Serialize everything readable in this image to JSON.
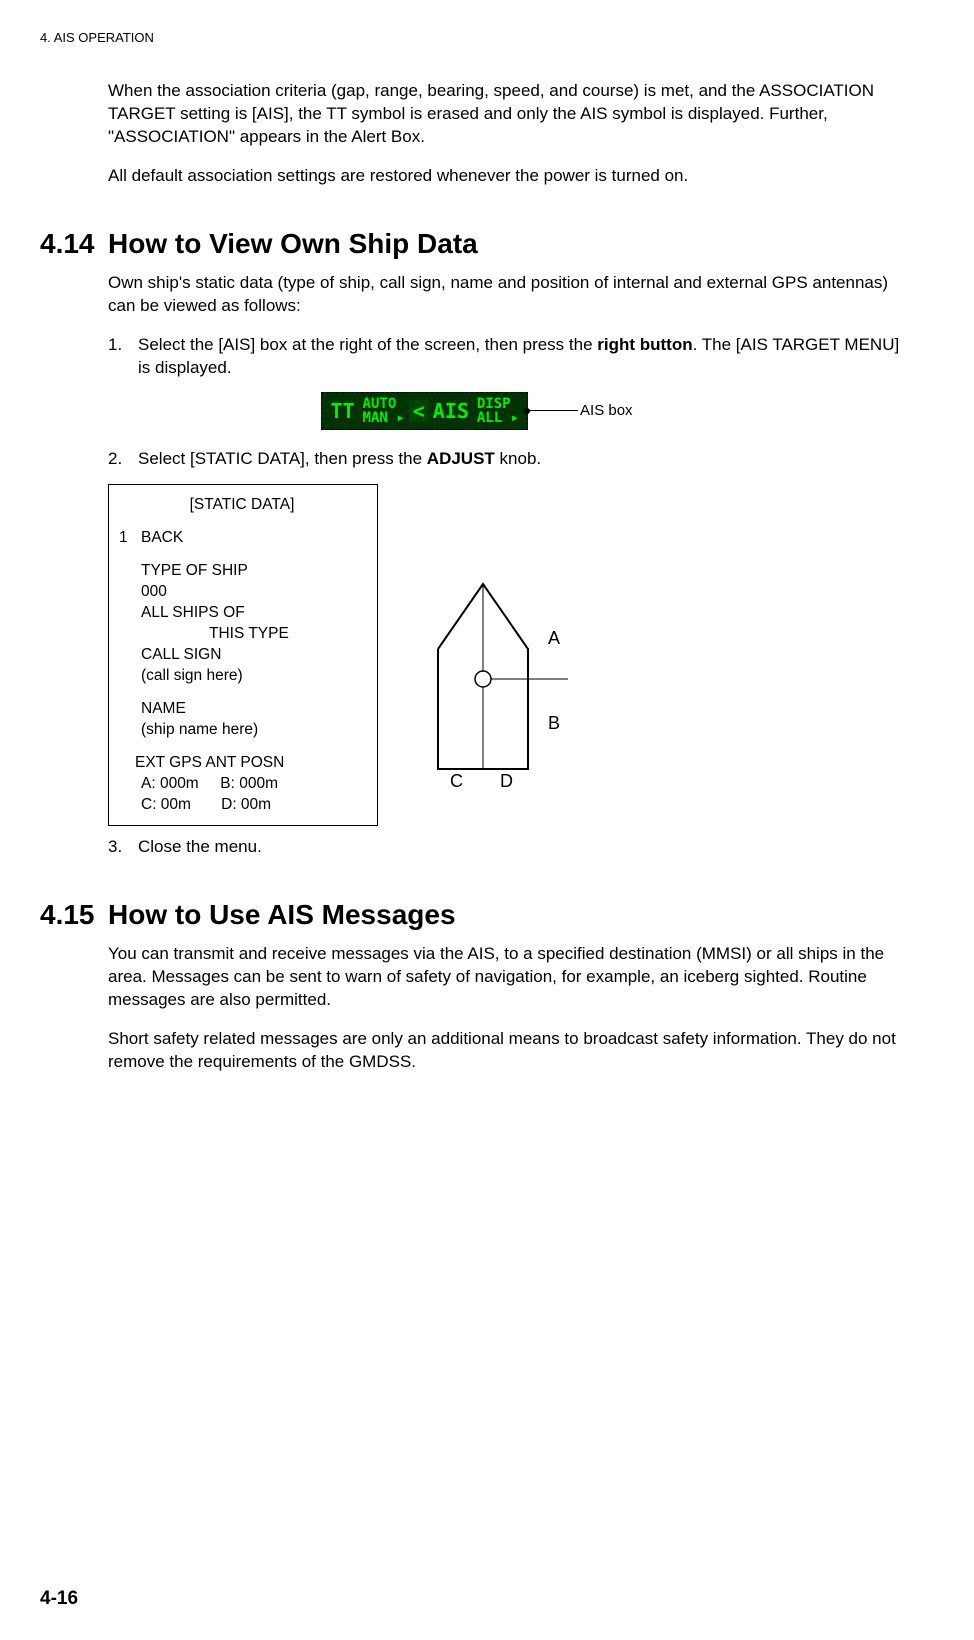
{
  "header": "4.  AIS OPERATION",
  "intro": {
    "p1": "When the association criteria (gap, range, bearing, speed, and course) is met, and the ASSOCIATION TARGET setting is [AIS], the TT symbol is erased and only the AIS symbol is displayed. Further, \"ASSOCIATION\" appears in the Alert Box.",
    "p2": "All default association settings are restored whenever the power is turned on."
  },
  "s414": {
    "num": "4.14",
    "title": "How to View Own Ship Data",
    "p1": "Own ship's static data (type of ship, call sign, name and position of internal and external GPS antennas) can be viewed as follows:",
    "step1_pre": "Select the [AIS] box at the right of the screen, then press the ",
    "step1_bold": "right button",
    "step1_post": ". The [AIS TARGET MENU] is displayed.",
    "ais_box": {
      "tt": "TT",
      "auto": "AUTO",
      "man": "MAN",
      "chev": "<",
      "ais": "AIS",
      "disp": "DISP",
      "all": "ALL",
      "label": "AIS box"
    },
    "step2_pre": "Select [STATIC DATA], then press the ",
    "step2_bold": "ADJUST",
    "step2_post": " knob.",
    "menu": {
      "title": "[STATIC DATA]",
      "item1num": "1",
      "item1": "BACK",
      "type_label": "TYPE OF SHIP",
      "type_val": "000",
      "allships1": "ALL SHIPS OF",
      "allships2": "THIS TYPE",
      "callsign_label": "CALL SIGN",
      "callsign_val": "(call sign here)",
      "name_label": "NAME",
      "name_val": "(ship name here)",
      "ext_label": "EXT GPS ANT POSN",
      "a": "A: 000m",
      "b": "B: 000m",
      "c": "C: 00m",
      "d": "D: 00m"
    },
    "diagram": {
      "A": "A",
      "B": "B",
      "C": "C",
      "D": "D"
    },
    "step3": "Close the menu."
  },
  "s415": {
    "num": "4.15",
    "title": "How to Use AIS Messages",
    "p1": "You can transmit and receive messages via the AIS, to a specified destination (MMSI) or all ships in the area. Messages can be sent to warn of safety of navigation, for example, an iceberg sighted. Routine messages are also permitted.",
    "p2": "Short safety related messages are only an additional means to broadcast safety information. They do not remove the requirements of the GMDSS."
  },
  "page_num": "4-16"
}
